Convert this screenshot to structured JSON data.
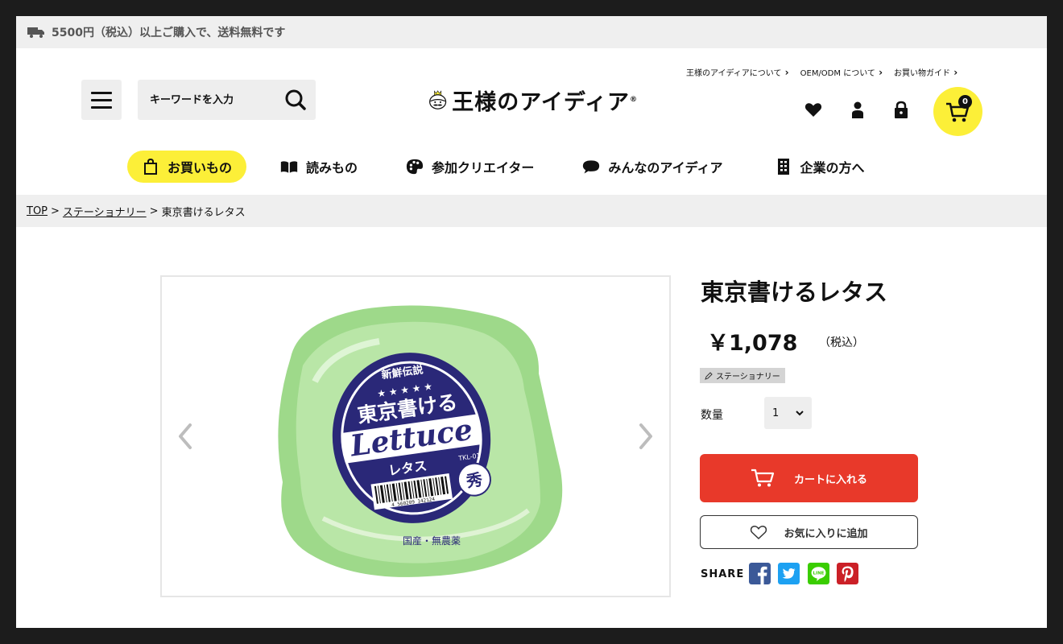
{
  "announcement": {
    "text": "5500円（税込）以上ご購入で、送料無料です"
  },
  "header": {
    "search_placeholder": "キーワードを入力",
    "logo_text": "王様のアイディア",
    "logo_mark": "®",
    "util_links": [
      "王様のアイディアについて",
      "OEM/ODM について",
      "お買い物ガイド"
    ],
    "cart_count": "0"
  },
  "nav": {
    "items": [
      {
        "label": "お買いもの",
        "icon": "shopping-bag-icon",
        "active": true
      },
      {
        "label": "読みもの",
        "icon": "book-icon"
      },
      {
        "label": "参加クリエイター",
        "icon": "palette-icon"
      },
      {
        "label": "みんなのアイディア",
        "icon": "speech-bubble-icon"
      },
      {
        "label": "企業の方へ",
        "icon": "building-icon"
      }
    ]
  },
  "breadcrumb": {
    "home": "TOP",
    "category": "ステーショナリー",
    "current": "東京書けるレタス",
    "separator": ">"
  },
  "product": {
    "title": "東京書けるレタス",
    "price": "￥1,078",
    "tax_note": "（税込）",
    "tag": "ステーショナリー",
    "quantity_label": "数量",
    "quantity_value": "1",
    "add_to_cart_label": "カートに入れる",
    "favorite_label": "お気に入りに追加",
    "share_label": "SHARE",
    "image_text": {
      "label_top": "新鮮伝説",
      "label_main": "東京書ける",
      "label_script": "Lettuce",
      "label_kana": "レタス",
      "label_code": "TKL-01",
      "label_badge": "秀",
      "barcode": "4 560209 142124",
      "bag_text": "国産・無農薬"
    }
  },
  "colors": {
    "accent_yellow": "#fcef38",
    "cart_red": "#e8392a",
    "facebook": "#3b5998",
    "twitter": "#1da1f2",
    "line": "#3acd01",
    "pinterest": "#cb2027"
  }
}
